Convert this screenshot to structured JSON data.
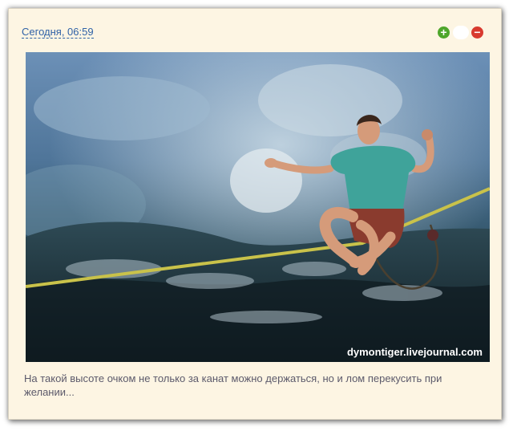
{
  "post": {
    "timestamp": "Сегодня, 06:59",
    "caption": "На такой высоте очком не только за канат можно держаться, но и лом перекусить при желании...",
    "photo": {
      "watermark": "dymontiger.livejournal.com"
    }
  },
  "rating": {
    "plus_icon": "plus-circle-icon",
    "minus_icon": "minus-circle-icon",
    "score": "",
    "colors": {
      "plus": "#4ea62b",
      "minus": "#d83a2f"
    }
  },
  "colors": {
    "frame_bg": "#fdf5e3",
    "link": "#2f62a7",
    "caption_text": "#5c5a6b"
  }
}
